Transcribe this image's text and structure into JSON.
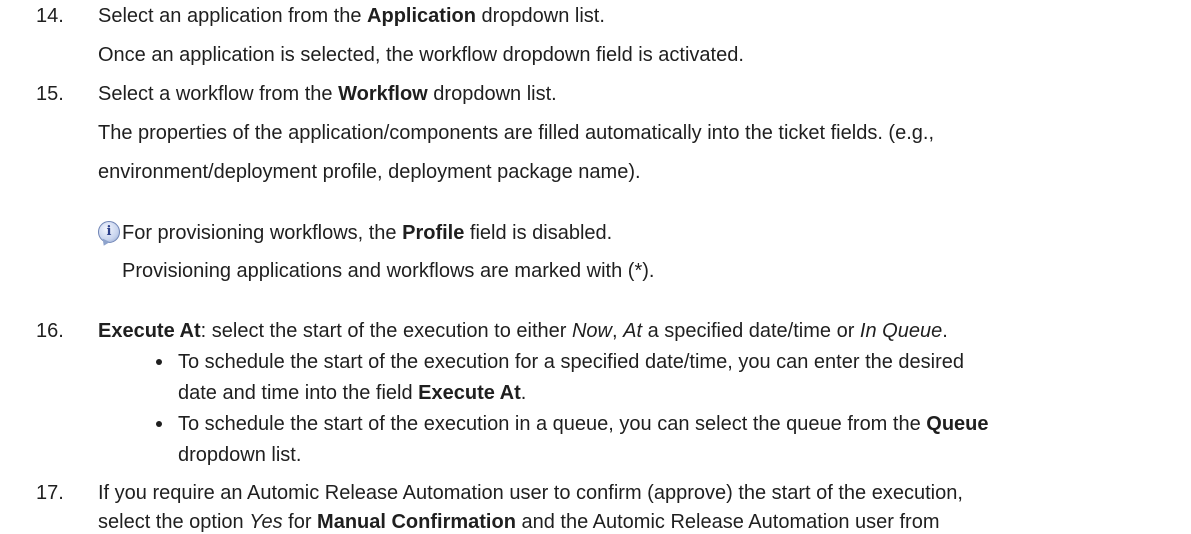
{
  "step14": {
    "number": "14.",
    "line1_pre": "Select an application from the ",
    "line1_bold": "Application",
    "line1_post": " dropdown list.",
    "line2": "Once an application is selected, the workflow dropdown field is activated."
  },
  "step15": {
    "number": "15.",
    "line1_pre": "Select a workflow from the ",
    "line1_bold": "Workflow",
    "line1_post": " dropdown list.",
    "line2": "The properties of the application/components are filled automatically into the ticket fields. (e.g.,",
    "line3": "environment/deployment profile, deployment package name).",
    "note_line1_pre": "For provisioning workflows, the ",
    "note_line1_bold": "Profile",
    "note_line1_post": " field is disabled.",
    "note_line2": "Provisioning applications and workflows are marked with (*)."
  },
  "step16": {
    "number": "16.",
    "line1_bold": "Execute At",
    "line1_a": ": select the start of the execution to either ",
    "line1_now": "Now",
    "line1_b": ", ",
    "line1_at": "At",
    "line1_c": " a specified date/time or ",
    "line1_inqueue": "In Queue",
    "line1_d": ".",
    "bullet1_line1": "To schedule the start of the execution for a specified date/time, you can enter the desired",
    "bullet1_line2_pre": "date and time into the field ",
    "bullet1_line2_bold": "Execute At",
    "bullet1_line2_post": ".",
    "bullet2_line1_pre": "To schedule the start of the execution in a queue, you can select the queue from the ",
    "bullet2_line1_bold": "Queue",
    "bullet2_line2": "dropdown list."
  },
  "step17": {
    "number": "17.",
    "line1": "If you require an Automic Release Automation user to confirm (approve) the start of the execution,",
    "line2_pre": "select the option ",
    "line2_yes": "Yes",
    "line2_a": " for ",
    "line2_bold": "Manual Confirmation",
    "line2_post": " and the Automic Release Automation user from"
  },
  "icons": {
    "note": "info-icon"
  },
  "colors": {
    "text": "#1f1f1f",
    "note_icon_fill": "#c8d4ee",
    "note_icon_glyph": "#2b3f8a"
  }
}
